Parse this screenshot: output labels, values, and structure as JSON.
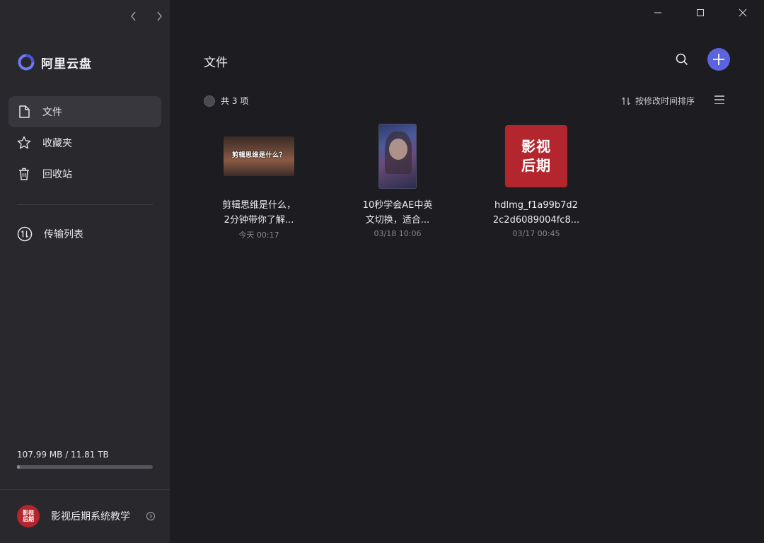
{
  "app": {
    "name": "阿里云盘"
  },
  "sidebar": {
    "items": [
      {
        "label": "文件",
        "icon": "file-icon",
        "active": true
      },
      {
        "label": "收藏夹",
        "icon": "star-icon",
        "active": false
      },
      {
        "label": "回收站",
        "icon": "trash-icon",
        "active": false
      }
    ],
    "transfer": {
      "label": "传输列表",
      "icon": "transfer-icon"
    },
    "storage": {
      "text": "107.99 MB / 11.81 TB",
      "used_fraction": 0.01
    },
    "user": {
      "name": "影视后期系统教学",
      "avatar_line1": "影视",
      "avatar_line2": "后期"
    }
  },
  "main": {
    "title": "文件",
    "count_label": "共 3 项",
    "sort_label": "按修改时间排序",
    "files": [
      {
        "name_line1": "剪辑思维是什么，",
        "name_line2": "2分钟带你了解...",
        "date": "今天 00:17",
        "thumb_text": "剪辑思维是什么？",
        "type": "video-landscape"
      },
      {
        "name_line1": "10秒学会AE中英",
        "name_line2": "文切换，适合...",
        "date": "03/18 10:06",
        "type": "video-portrait"
      },
      {
        "name_line1": "hdlmg_f1a99b7d2",
        "name_line2": "2c2d6089004fc8...",
        "date": "03/17 00:45",
        "thumb_line1": "影视",
        "thumb_line2": "后期",
        "type": "image"
      }
    ]
  },
  "colors": {
    "accent": "#5b63de",
    "sidebar_bg": "#28282d",
    "main_bg": "#1d1d21",
    "brand_red": "#b3262d"
  }
}
